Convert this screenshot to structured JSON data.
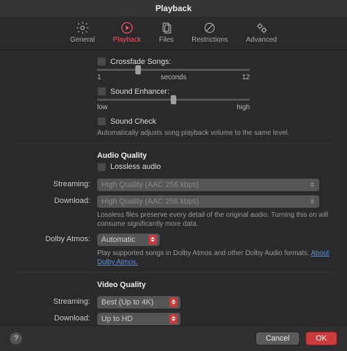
{
  "title": "Playback",
  "tabs": {
    "general": "General",
    "playback": "Playback",
    "files": "Files",
    "restrictions": "Restrictions",
    "advanced": "Advanced"
  },
  "crossfade": {
    "label": "Crossfade Songs:",
    "min": "1",
    "mid": "seconds",
    "max": "12"
  },
  "enhancer": {
    "label": "Sound Enhancer:",
    "low": "low",
    "high": "high"
  },
  "soundcheck": {
    "label": "Sound Check",
    "help": "Automatically adjusts song playback volume to the same level."
  },
  "audioQuality": {
    "head": "Audio Quality",
    "lossless": "Lossless audio",
    "streamingLabel": "Streaming:",
    "streamingValue": "High Quality (AAC 256 kbps)",
    "downloadLabel": "Download:",
    "downloadValue": "High Quality (AAC 256 kbps)",
    "help": "Lossless files preserve every detail of the original audio. Turning this on will consume significantly more data."
  },
  "dolby": {
    "label": "Dolby Atmos:",
    "value": "Automatic",
    "help": "Play supported songs in Dolby Atmos and other Dolby Audio formats.",
    "link": "About Dolby Atmos."
  },
  "videoQuality": {
    "head": "Video Quality",
    "streamingLabel": "Streaming:",
    "streamingValue": "Best (Up to 4K)",
    "downloadLabel": "Download:",
    "downloadValue": "Up to HD"
  },
  "footer": {
    "help": "?",
    "cancel": "Cancel",
    "ok": "OK"
  }
}
